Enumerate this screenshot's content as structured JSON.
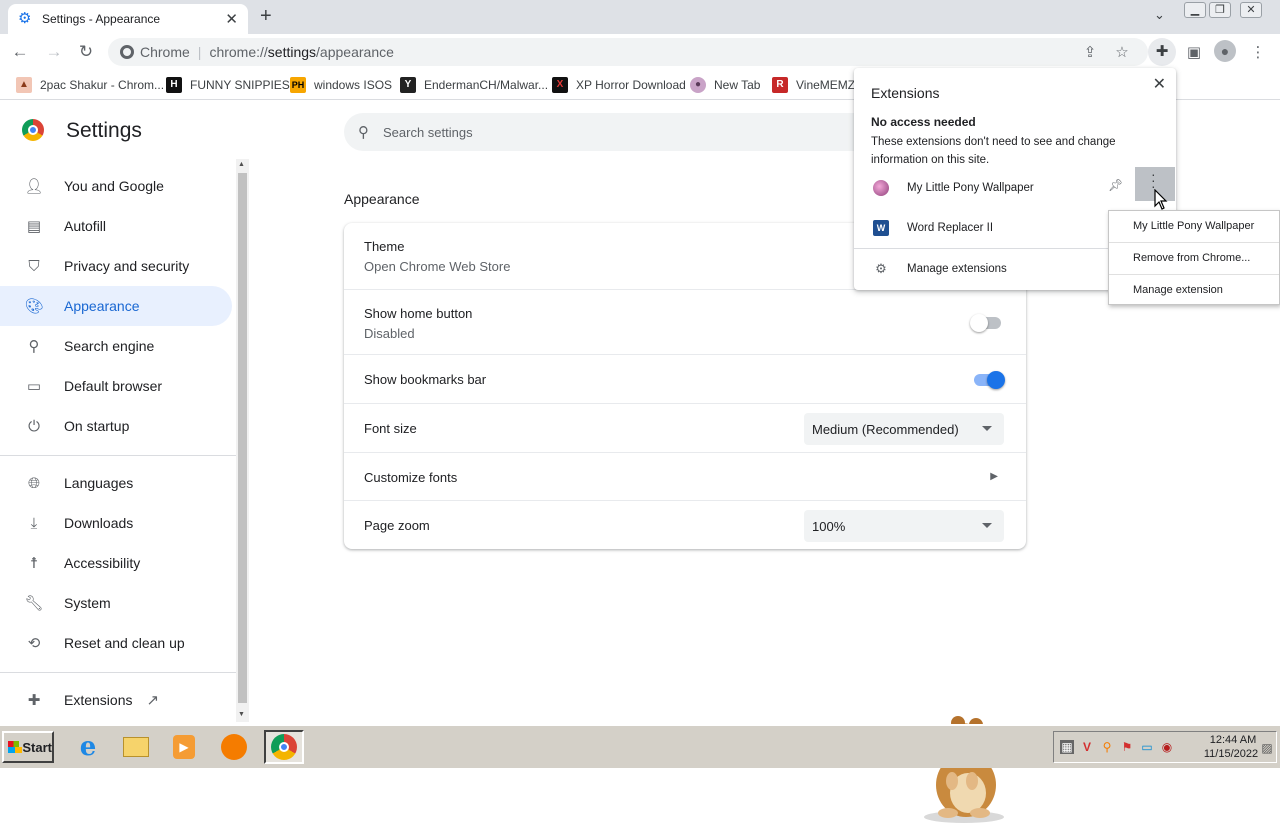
{
  "browser": {
    "tab_title": "Settings - Appearance",
    "omnibox": {
      "site_label": "Chrome",
      "url_scheme": "chrome://",
      "url_host": "settings",
      "url_path": "/appearance"
    }
  },
  "bookmarks": [
    {
      "label": "2pac Shakur - Chrom...",
      "icon": "2pac-favicon"
    },
    {
      "label": "FUNNY SNIPPIES",
      "icon": "H"
    },
    {
      "label": "windows ISOS",
      "icon": "PH"
    },
    {
      "label": "EndermanCH/Malwar...",
      "icon": "Y"
    },
    {
      "label": "XP Horror Download",
      "icon": "X"
    },
    {
      "label": "New Tab",
      "icon": "newtab-favicon"
    },
    {
      "label": "VineMEMZ",
      "icon": "R"
    }
  ],
  "settings": {
    "title": "Settings",
    "search_placeholder": "Search settings",
    "nav": [
      {
        "label": "You and Google",
        "icon": "person-icon"
      },
      {
        "label": "Autofill",
        "icon": "clipboard-icon"
      },
      {
        "label": "Privacy and security",
        "icon": "shield-icon"
      },
      {
        "label": "Appearance",
        "icon": "palette-icon",
        "active": true
      },
      {
        "label": "Search engine",
        "icon": "search-icon"
      },
      {
        "label": "Default browser",
        "icon": "browser-icon"
      },
      {
        "label": "On startup",
        "icon": "power-icon"
      },
      {
        "label": "Languages",
        "icon": "globe-icon"
      },
      {
        "label": "Downloads",
        "icon": "download-icon"
      },
      {
        "label": "Accessibility",
        "icon": "accessibility-icon"
      },
      {
        "label": "System",
        "icon": "wrench-icon"
      },
      {
        "label": "Reset and clean up",
        "icon": "restore-icon"
      },
      {
        "label": "Extensions",
        "icon": "puzzle-icon"
      }
    ],
    "section_title": "Appearance",
    "rows": {
      "theme": {
        "label": "Theme",
        "sub": "Open Chrome Web Store"
      },
      "home_button": {
        "label": "Show home button",
        "sub": "Disabled",
        "enabled": false
      },
      "bookmarks_bar": {
        "label": "Show bookmarks bar",
        "enabled": true
      },
      "font_size": {
        "label": "Font size",
        "value": "Medium (Recommended)"
      },
      "customize_fonts": {
        "label": "Customize fonts"
      },
      "page_zoom": {
        "label": "Page zoom",
        "value": "100%"
      }
    }
  },
  "extensions_popup": {
    "title": "Extensions",
    "heading": "No access needed",
    "description": "These extensions don't need to see and change information on this site.",
    "items": [
      {
        "name": "My Little Pony Wallpaper",
        "pinned": true
      },
      {
        "name": "Word Replacer II"
      }
    ],
    "manage_label": "Manage extensions"
  },
  "context_menu": {
    "items": [
      "My Little Pony Wallpaper",
      "Remove from Chrome...",
      "Manage extension"
    ]
  },
  "taskbar": {
    "start_label": "Start",
    "clock_time": "12:44 AM",
    "clock_date": "11/15/2022"
  },
  "colors": {
    "accent": "#1a73e8",
    "active_nav_bg": "#e8f0fe",
    "toggle_on": "#1a73e8"
  }
}
